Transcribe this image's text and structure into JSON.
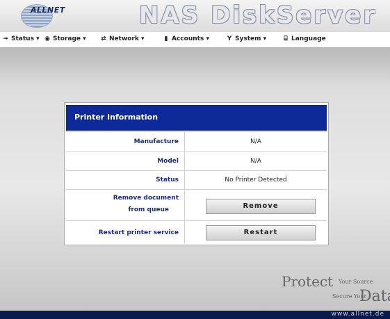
{
  "header": {
    "brand": "ALLNET",
    "title": "NAS DiskServer"
  },
  "nav": [
    {
      "label": "Status",
      "icon": "status-icon"
    },
    {
      "label": "Storage",
      "icon": "storage-icon"
    },
    {
      "label": "Network",
      "icon": "network-icon"
    },
    {
      "label": "Accounts",
      "icon": "accounts-icon"
    },
    {
      "label": "System",
      "icon": "system-icon"
    },
    {
      "label": "Language",
      "icon": "language-icon"
    }
  ],
  "panel": {
    "title": "Printer Information",
    "rows": {
      "manufacture": {
        "label": "Manufacture",
        "value": "N/A"
      },
      "model": {
        "label": "Model",
        "value": "N/A"
      },
      "status": {
        "label": "Status",
        "value": "No Printer Detected"
      },
      "remove": {
        "label_line1": "Remove document",
        "label_line2": "from queue",
        "button": "Remove"
      },
      "restart": {
        "label": "Restart printer service",
        "button": "Restart"
      }
    }
  },
  "branding": {
    "protect": "Protect",
    "your_source": "Your Source",
    "secure_your": "Secure Your",
    "data": "Data"
  },
  "footer": {
    "url": "www.allnet.de"
  },
  "colors": {
    "panel_header": "#0d2a98",
    "label_text": "#1a2c7a",
    "footer": "#0a1a4d"
  }
}
